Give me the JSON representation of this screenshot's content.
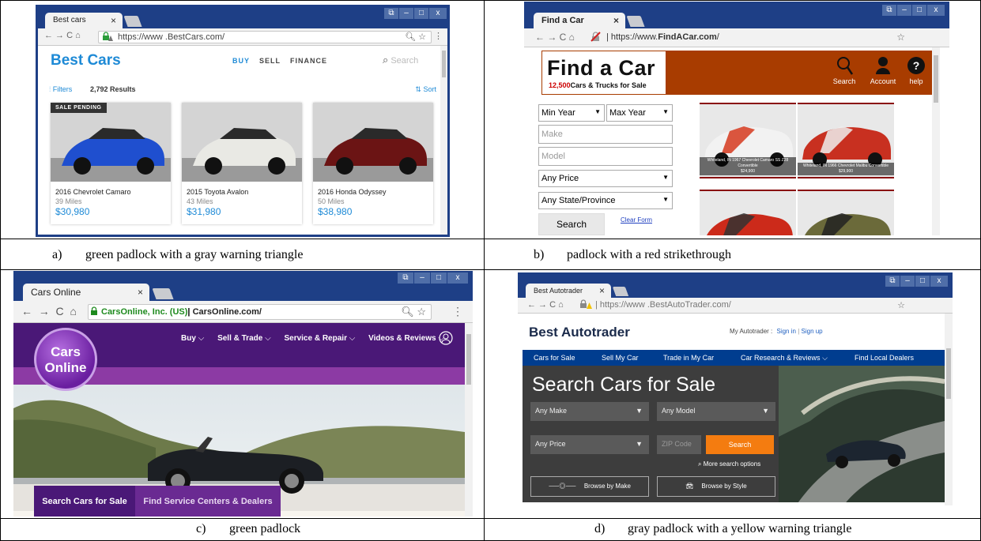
{
  "panels": [
    {
      "id": "a",
      "caption_letter": "a)",
      "caption": "green padlock with a gray warning triangle",
      "tab_title": "Best cars",
      "url": "https://www .BestCars.com/",
      "site_title": "Best Cars",
      "nav": [
        "BUY",
        "SELL",
        "FINANCE"
      ],
      "search_placeholder": "Search",
      "filters_label": "Filters",
      "results": "2,792 Results",
      "sort_label": "Sort",
      "badge": "SALE PENDING",
      "cars": [
        {
          "name": "2016 Chevrolet Camaro",
          "miles": "39 Miles",
          "price": "$30,980"
        },
        {
          "name": "2015 Toyota Avalon",
          "miles": "43 Miles",
          "price": "$31,980"
        },
        {
          "name": "2016 Honda Odyssey",
          "miles": "50 Miles",
          "price": "$38,980"
        }
      ]
    },
    {
      "id": "b",
      "caption_letter": "b)",
      "caption": "padlock with a red strikethrough",
      "tab_title": "Find a Car",
      "url_prefix": "https://www.",
      "url_bold": "FindACar.com",
      "url_suffix": "/",
      "site_title": "Find a Car",
      "count": "12,500",
      "count_suffix": "Cars & Trucks for Sale",
      "header_links": [
        "Search",
        "Account",
        "help"
      ],
      "fields": {
        "min_year": "Min Year",
        "max_year": "Max Year",
        "make": "Make",
        "model": "Model",
        "price": "Any Price",
        "state": "Any State/Province"
      },
      "search_button": "Search",
      "clear_form": "Clear Form",
      "thumbs": [
        {
          "caption": "Whiteland, IN 1967 Chevrolet Camaro SS Z28 Convertible",
          "price": "$24,900"
        },
        {
          "caption": "Whiteland, IN 1966 Chevrolet Malibu Convertible",
          "price": "$29,900"
        }
      ]
    },
    {
      "id": "c",
      "caption_letter": "c)",
      "caption": "green padlock",
      "tab_title": "Cars Online",
      "ev_org": "CarsOnline, Inc. (US)",
      "url": "CarsOnline.com/",
      "logo_line1": "Cars",
      "logo_line2": "Online",
      "nav": [
        "Buy",
        "Sell & Trade",
        "Service & Repair",
        "Videos & Reviews"
      ],
      "tabs": [
        "Search Cars for Sale",
        "Find Service Centers & Dealers"
      ]
    },
    {
      "id": "d",
      "caption_letter": "d)",
      "caption": "gray padlock with a yellow warning triangle",
      "tab_title": "Best Autotrader",
      "url": "https://www .BestAutoTrader.com/",
      "site_title": "Best Autotrader",
      "account_label": "My Autotrader :",
      "sign_in": "Sign in",
      "sign_up": "Sign up",
      "nav": [
        "Cars for Sale",
        "Sell My Car",
        "Trade in My Car",
        "Car Research & Reviews",
        "Find Local Dealers"
      ],
      "hero_title": "Search Cars for Sale",
      "any_make": "Any Make",
      "any_model": "Any Model",
      "any_price": "Any Price",
      "zip_placeholder": "ZIP Code",
      "search_button": "Search",
      "more_options": "More search options",
      "browse_make": "Browse by Make",
      "browse_style": "Browse by Style"
    }
  ],
  "colors": {
    "titlebar": "#1e3f86",
    "bestcars_blue": "#1e8ad6",
    "findacar_banner": "#a83c00",
    "carsonline_purple": "#5b1e8a",
    "autotrader_nav": "#003d8f",
    "autotrader_orange": "#f47c10",
    "ssl_green": "#1e8a1e"
  }
}
